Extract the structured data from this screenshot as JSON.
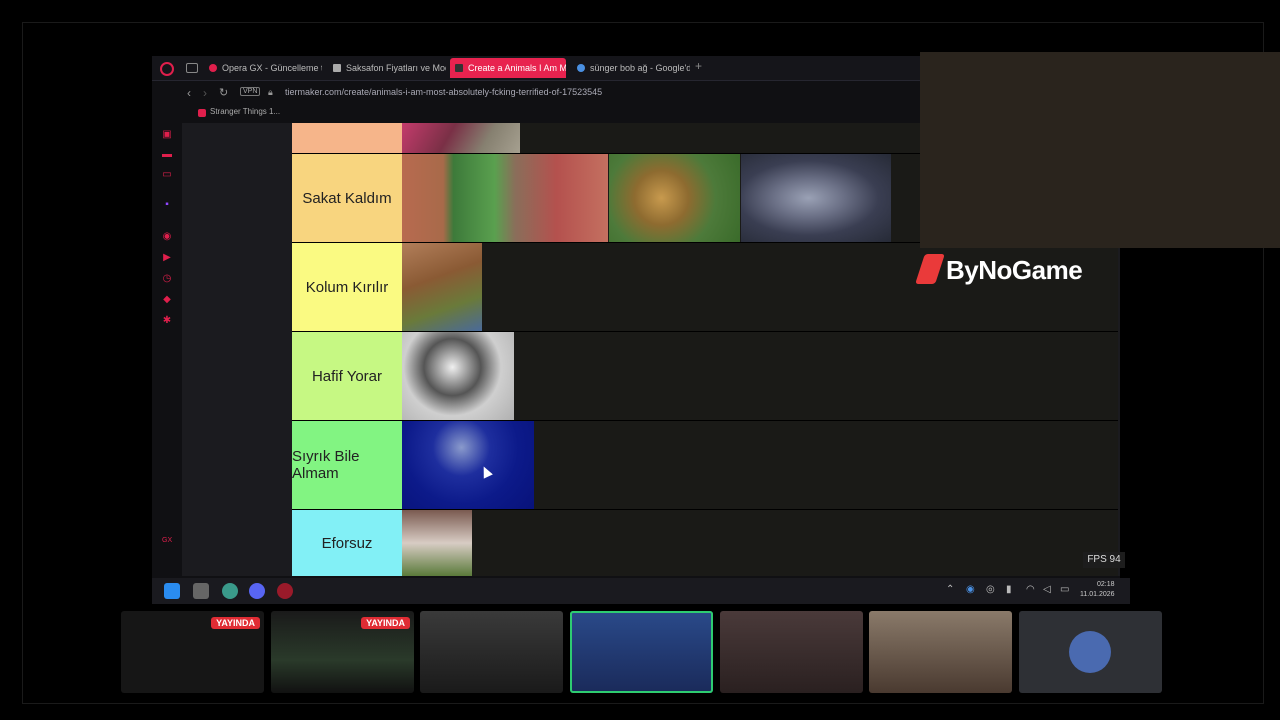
{
  "browser": {
    "tabs": [
      {
        "label": "Opera GX - Güncelleme ta",
        "icon": "opera-icon",
        "active": false
      },
      {
        "label": "Saksafon Fiyatları ve Mod",
        "icon": "page-icon",
        "active": false
      },
      {
        "label": "Create a Animals I Am Mo",
        "icon": "tiermaker-icon",
        "active": true
      },
      {
        "label": "sünger bob ağ - Google'd",
        "icon": "google-icon",
        "active": false
      }
    ],
    "new_tab": "+",
    "vpn": "VPN",
    "url": "tiermaker.com/create/animals-i-am-most-absolutely-fcking-terrified-of-17523545",
    "bookmark": "Stranger Things 1..."
  },
  "tiers": [
    {
      "label": "",
      "color": "#f6b58a"
    },
    {
      "label": "Sakat Kaldım",
      "color": "#f8d57f"
    },
    {
      "label": "Kolum Kırılır",
      "color": "#fafa82"
    },
    {
      "label": "Hafif Yorar",
      "color": "#c6f883"
    },
    {
      "label": "Sıyrık Bile Almam",
      "color": "#82f482"
    },
    {
      "label": "Eforsuz",
      "color": "#82f0f6"
    }
  ],
  "overlay": {
    "logo": "ByNoGame",
    "fps": "FPS 94"
  },
  "taskbar": {
    "time": "02:18",
    "date": "11.01.2026"
  },
  "cams": {
    "live_label": "YAYINDA"
  },
  "colors": {
    "accent": "#e8234f",
    "live_badge": "#e02c34"
  }
}
